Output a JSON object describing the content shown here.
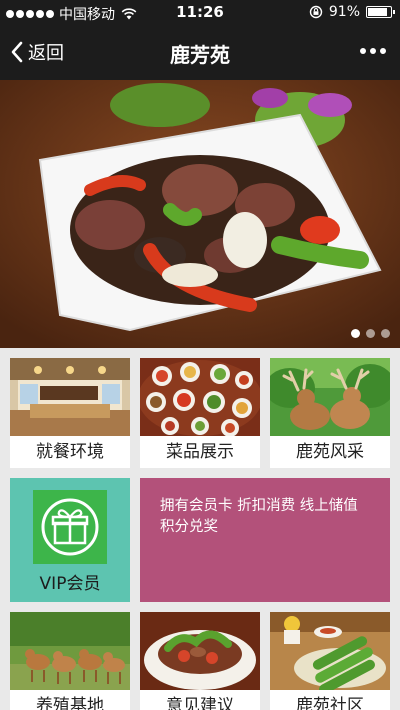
{
  "status_bar": {
    "carrier": "中国移动",
    "time": "11:26",
    "battery": "91%",
    "battery_level": 0.91
  },
  "nav": {
    "back_label": "返回",
    "title": "鹿芳苑",
    "more_icon": "more-dots-icon"
  },
  "banner": {
    "slide_count": 3,
    "active_slide": 1
  },
  "tiles": {
    "dining": {
      "label": "就餐环境"
    },
    "dishes": {
      "label": "菜品展示"
    },
    "style": {
      "label": "鹿苑风采"
    },
    "vip": {
      "label": "VIP会员",
      "icon": "gift-icon"
    },
    "member_info": {
      "text": "拥有会员卡 折扣消费 线上储值 积分兑奖"
    },
    "farm": {
      "label": "养殖基地"
    },
    "feedback": {
      "label": "意见建议"
    },
    "community": {
      "label": "鹿苑社区"
    }
  },
  "colors": {
    "header_bg": "#1c1c1c",
    "vip_bg": "#5dc4b0",
    "vip_icon_bg": "#3db54a",
    "member_bg": "#b3517a",
    "page_bg": "#e9e9e9"
  }
}
